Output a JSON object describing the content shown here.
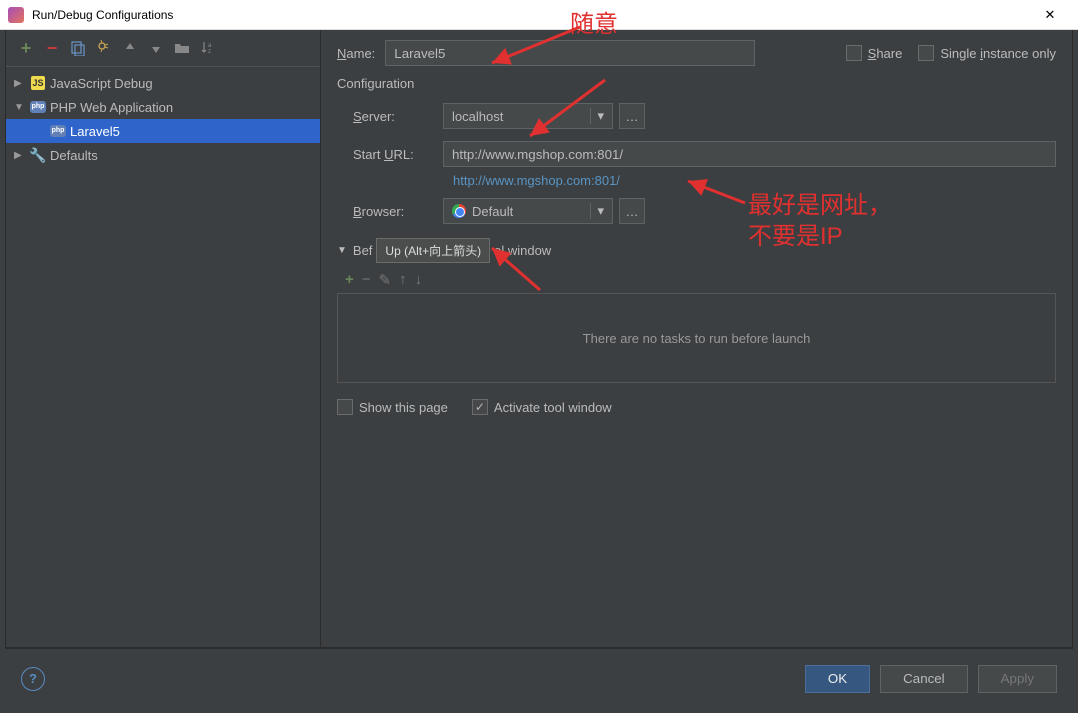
{
  "titlebar": {
    "title": "Run/Debug Configurations"
  },
  "tree": {
    "items": [
      {
        "label": "JavaScript Debug",
        "expandable": true,
        "expanded": false,
        "icon": "js"
      },
      {
        "label": "PHP Web Application",
        "expandable": true,
        "expanded": true,
        "icon": "php"
      },
      {
        "label": "Laravel5",
        "child": true,
        "selected": true,
        "icon": "php"
      },
      {
        "label": "Defaults",
        "expandable": true,
        "expanded": false,
        "icon": "wrench"
      }
    ]
  },
  "form": {
    "name_label": "Name:",
    "name_value": "Laravel5",
    "share_label": "Share",
    "single_instance_label": "Single instance only",
    "configuration_title": "Configuration",
    "server_label": "Server:",
    "server_value": "localhost",
    "start_url_label": "Start URL:",
    "start_url_value": "http://www.mgshop.com:801/",
    "start_url_link": "http://www.mgshop.com:801/",
    "browser_label": "Browser:",
    "browser_value": "Default",
    "before_launch_label": "Before launch: Activate tool window",
    "tooltip_text": "Up (Alt+向上箭头)",
    "no_tasks_text": "There are no tasks to run before launch",
    "show_this_page_label": "Show this page",
    "activate_tool_window_label": "Activate tool window",
    "activate_tool_window_checked": true
  },
  "footer": {
    "ok": "OK",
    "cancel": "Cancel",
    "apply": "Apply"
  },
  "annotations": {
    "a1": "随意",
    "a2_line1": "最好是网址，",
    "a2_line2": "不要是IP"
  }
}
